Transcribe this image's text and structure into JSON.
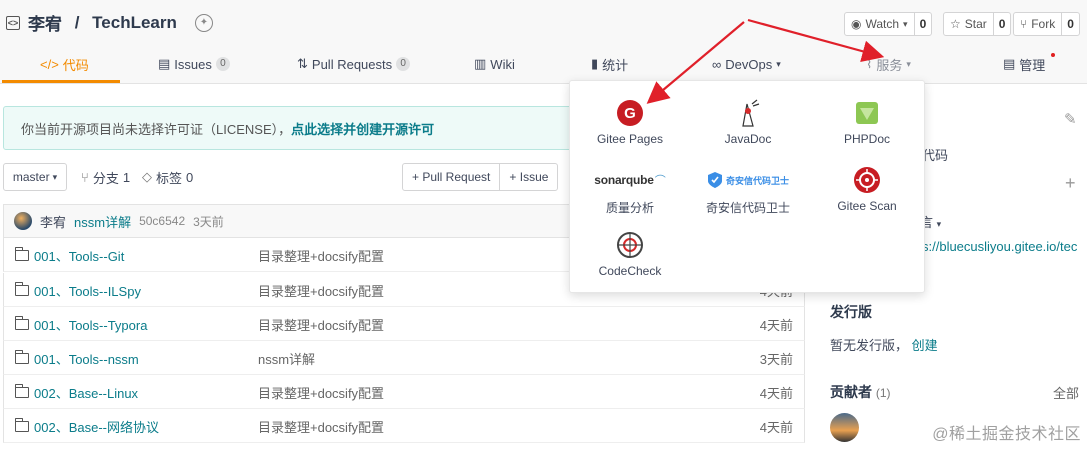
{
  "repo": {
    "owner": "李宥",
    "separator": " / ",
    "name": "TechLearn"
  },
  "actions": {
    "watch": {
      "label": "Watch",
      "count": "0"
    },
    "star": {
      "label": "Star",
      "count": "0"
    },
    "fork": {
      "label": "Fork",
      "count": "0"
    }
  },
  "nav": {
    "code": "代码",
    "issues": "Issues",
    "issues_count": "0",
    "pull_requests": "Pull Requests",
    "pull_requests_count": "0",
    "wiki": "Wiki",
    "stats": "统计",
    "devops": "DevOps",
    "services": "服务",
    "manage": "管理"
  },
  "notice": {
    "text": "你当前开源项目尚未选择许可证（LICENSE），",
    "link": "点此选择并创建开源许可"
  },
  "branch": {
    "current": "master",
    "branches_label": "分支",
    "branches_count": "1",
    "tags_label": "标签",
    "tags_count": "0",
    "pull_request_btn": "+ Pull Request",
    "issue_btn": "+ Issue"
  },
  "last_commit": {
    "author": "李宥",
    "message": "nssm详解",
    "hash": "50c6542",
    "time": "3天前"
  },
  "files": [
    {
      "name": "001、Tools--Git",
      "message": "目录整理+docsify配置",
      "time": ""
    },
    {
      "name": "001、Tools--ILSpy",
      "message": "目录整理+docsify配置",
      "time": "4天前"
    },
    {
      "name": "001、Tools--Typora",
      "message": "目录整理+docsify配置",
      "time": "4天前"
    },
    {
      "name": "001、Tools--nssm",
      "message": "nssm详解",
      "time": "3天前"
    },
    {
      "name": "002、Base--Linux",
      "message": "目录整理+docsify配置",
      "time": "4天前"
    },
    {
      "name": "002、Base--网络协议",
      "message": "目录整理+docsify配置",
      "time": "4天前"
    }
  ],
  "sidebar": {
    "desc_fragment": "代码",
    "lang_fragment": "言",
    "url_fragment": "s://bluecusliyou.gitee.io/tec",
    "releases_title": "发行版",
    "no_release": "暂无发行版，",
    "create_link": "创建",
    "contributors_title": "贡献者",
    "contributors_count": "(1)",
    "all_link": "全部"
  },
  "services": [
    {
      "label": "Gitee Pages",
      "icon": "gitee-pages-icon"
    },
    {
      "label": "JavaDoc",
      "icon": "javadoc-icon"
    },
    {
      "label": "PHPDoc",
      "icon": "phpdoc-icon"
    },
    {
      "label": "质量分析",
      "icon": "sonarqube-icon",
      "logo_text": "sonarqube"
    },
    {
      "label": "奇安信代码卫士",
      "icon": "qianxin-icon",
      "logo_text": "奇安信代码卫士"
    },
    {
      "label": "Gitee Scan",
      "icon": "gitee-scan-icon"
    },
    {
      "label": "CodeCheck",
      "icon": "codecheck-icon"
    }
  ],
  "watermark": "@稀土掘金技术社区",
  "colors": {
    "accent": "#f38b00",
    "link": "#0b7c8a",
    "arrow": "#e0202a",
    "gitee_red": "#c71d23"
  }
}
